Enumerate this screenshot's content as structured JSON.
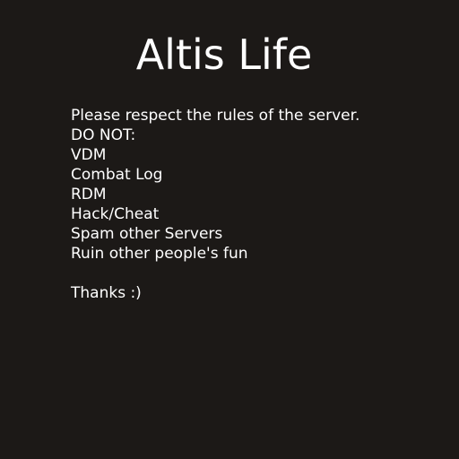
{
  "screen": {
    "title": "Altis Life",
    "intro": "Please respect the rules of the server.",
    "do_not_heading": "DO NOT:",
    "rules": [
      "VDM",
      "Combat Log",
      "RDM",
      "Hack/Cheat",
      "Spam other Servers",
      "Ruin other people's fun"
    ],
    "closing": "Thanks :)"
  },
  "colors": {
    "background": "#1c1917",
    "text": "#ffffff"
  }
}
